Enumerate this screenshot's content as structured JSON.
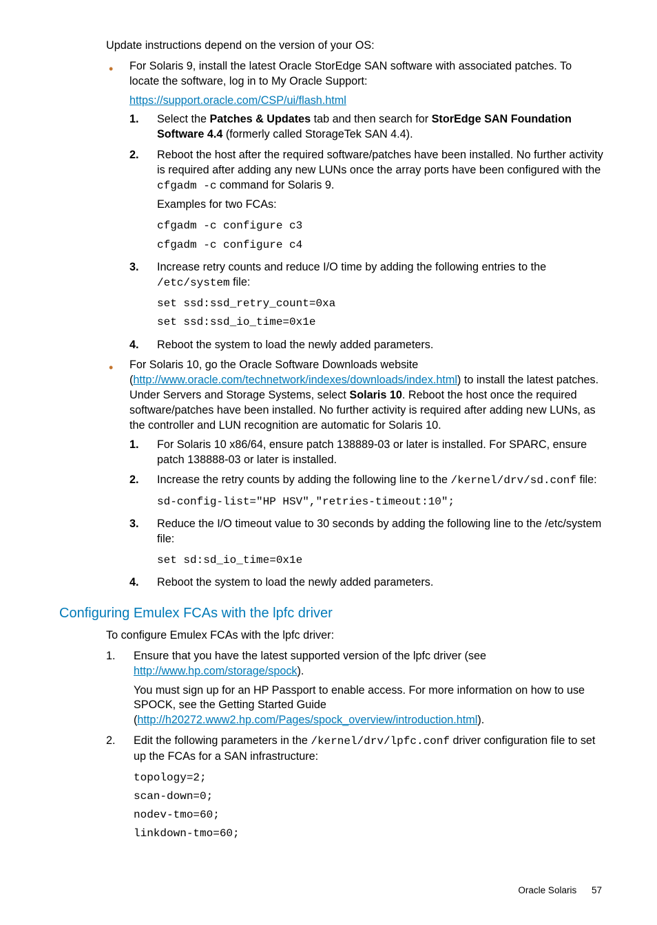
{
  "intro": "Update instructions depend on the version of your OS:",
  "bullet1": {
    "lead": "For Solaris 9, install the latest Oracle StorEdge SAN software with associated patches. To locate the software, log in to My Oracle Support:",
    "link": "https://support.oracle.com/CSP/ui/flash.html",
    "steps": {
      "s1a": "Select the ",
      "s1b": "Patches & Updates",
      "s1c": " tab and then search for ",
      "s1d": "StorEdge SAN Foundation Software 4.4",
      "s1e": " (formerly called StorageTek SAN 4.4).",
      "s2a": "Reboot the host after the required software/patches have been installed. No further activity is required after adding any new LUNs once the array ports have been configured with the ",
      "s2code": "cfgadm -c",
      "s2b": " command for Solaris 9.",
      "s2ex": "Examples for two FCAs:",
      "s2block": "cfgadm -c configure c3\ncfgadm -c configure c4",
      "s3a": "Increase retry counts and reduce I/O time by adding the following entries to the ",
      "s3code": "/etc/system",
      "s3b": " file:",
      "s3block": "set ssd:ssd_retry_count=0xa\nset ssd:ssd_io_time=0x1e",
      "s4": "Reboot the system to load the newly added parameters."
    }
  },
  "bullet2": {
    "leadA": "For Solaris 10, go the Oracle Software Downloads website (",
    "link": "http://www.oracle.com/technetwork/indexes/downloads/index.html",
    "leadB": ") to install the latest patches. Under Servers and Storage Systems, select ",
    "bold": "Solaris 10",
    "leadC": ". Reboot the host once the required software/patches have been installed. No further activity is required after adding new LUNs, as the controller and LUN recognition are automatic for Solaris 10.",
    "steps": {
      "s1": "For Solaris 10 x86/64, ensure patch 138889-03 or later is installed. For SPARC, ensure patch 138888-03 or later is installed.",
      "s2a": "Increase the retry counts by adding the following line to the ",
      "s2code": "/kernel/drv/sd.conf",
      "s2b": " file:",
      "s2block": "sd-config-list=\"HP HSV\",\"retries-timeout:10\";",
      "s3a": "Reduce the I/O timeout value to 30 seconds by adding the following line to the /etc/system file:",
      "s3block": "set sd:sd_io_time=0x1e",
      "s4": "Reboot the system to load the newly added parameters."
    }
  },
  "section_title": "Configuring Emulex FCAs with the lpfc driver",
  "section_intro": "To configure Emulex FCAs with the lpfc driver:",
  "sectSteps": {
    "s1a": "Ensure that you have the latest supported version of the lpfc driver (see ",
    "s1link": "http://www.hp.com/storage/spock",
    "s1b": ").",
    "s1p2a": "You must sign up for an HP Passport to enable access. For more information on how to use SPOCK, see the Getting Started Guide (",
    "s1p2link": "http://h20272.www2.hp.com/Pages/spock_overview/introduction.html",
    "s1p2b": ").",
    "s2a": "Edit the following parameters in the ",
    "s2code": "/kernel/drv/lpfc.conf",
    "s2b": " driver configuration file to set up the FCAs for a SAN infrastructure:",
    "s2block": "topology=2;\nscan-down=0;\nnodev-tmo=60;\nlinkdown-tmo=60;"
  },
  "footer_label": "Oracle Solaris",
  "footer_page": "57",
  "nums": {
    "n1": "1.",
    "n2": "2.",
    "n3": "3.",
    "n4": "4."
  }
}
